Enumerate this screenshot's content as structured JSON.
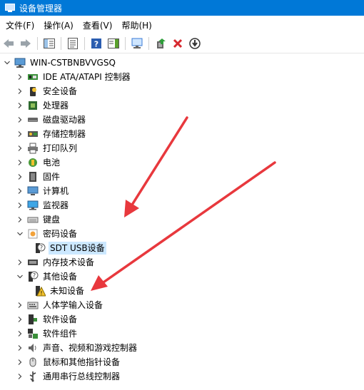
{
  "window": {
    "title": "设备管理器"
  },
  "menu": [
    "文件(F)",
    "操作(A)",
    "查看(V)",
    "帮助(H)"
  ],
  "tree": {
    "root": "WIN-CSTBNBVVGSQ",
    "items": [
      {
        "label": "IDE ATA/ATAPI 控制器",
        "icon": "ide-controller-icon"
      },
      {
        "label": "安全设备",
        "icon": "security-device-icon"
      },
      {
        "label": "处理器",
        "icon": "processor-icon"
      },
      {
        "label": "磁盘驱动器",
        "icon": "disk-drive-icon"
      },
      {
        "label": "存储控制器",
        "icon": "storage-controller-icon"
      },
      {
        "label": "打印队列",
        "icon": "printer-icon"
      },
      {
        "label": "电池",
        "icon": "battery-icon"
      },
      {
        "label": "固件",
        "icon": "firmware-icon"
      },
      {
        "label": "计算机",
        "icon": "computer-icon"
      },
      {
        "label": "监视器",
        "icon": "monitor-icon"
      },
      {
        "label": "键盘",
        "icon": "keyboard-icon"
      },
      {
        "label": "密码设备",
        "icon": "password-device-icon",
        "expanded": true
      },
      {
        "label": "SDT USB设备",
        "icon": "unknown-device-icon",
        "child": true,
        "selected": true
      },
      {
        "label": "内存技术设备",
        "icon": "memory-device-icon"
      },
      {
        "label": "其他设备",
        "icon": "other-device-icon",
        "expanded": true
      },
      {
        "label": "未知设备",
        "icon": "warning-device-icon",
        "child": true
      },
      {
        "label": "人体学输入设备",
        "icon": "hid-icon"
      },
      {
        "label": "软件设备",
        "icon": "software-device-icon"
      },
      {
        "label": "软件组件",
        "icon": "software-component-icon"
      },
      {
        "label": "声音、视频和游戏控制器",
        "icon": "sound-icon"
      },
      {
        "label": "鼠标和其他指针设备",
        "icon": "mouse-icon"
      },
      {
        "label": "通用串行总线控制器",
        "icon": "usb-icon"
      }
    ]
  },
  "colors": {
    "titlebar": "#0078d7",
    "selection": "#cce8ff",
    "arrow": "#e8383d"
  }
}
